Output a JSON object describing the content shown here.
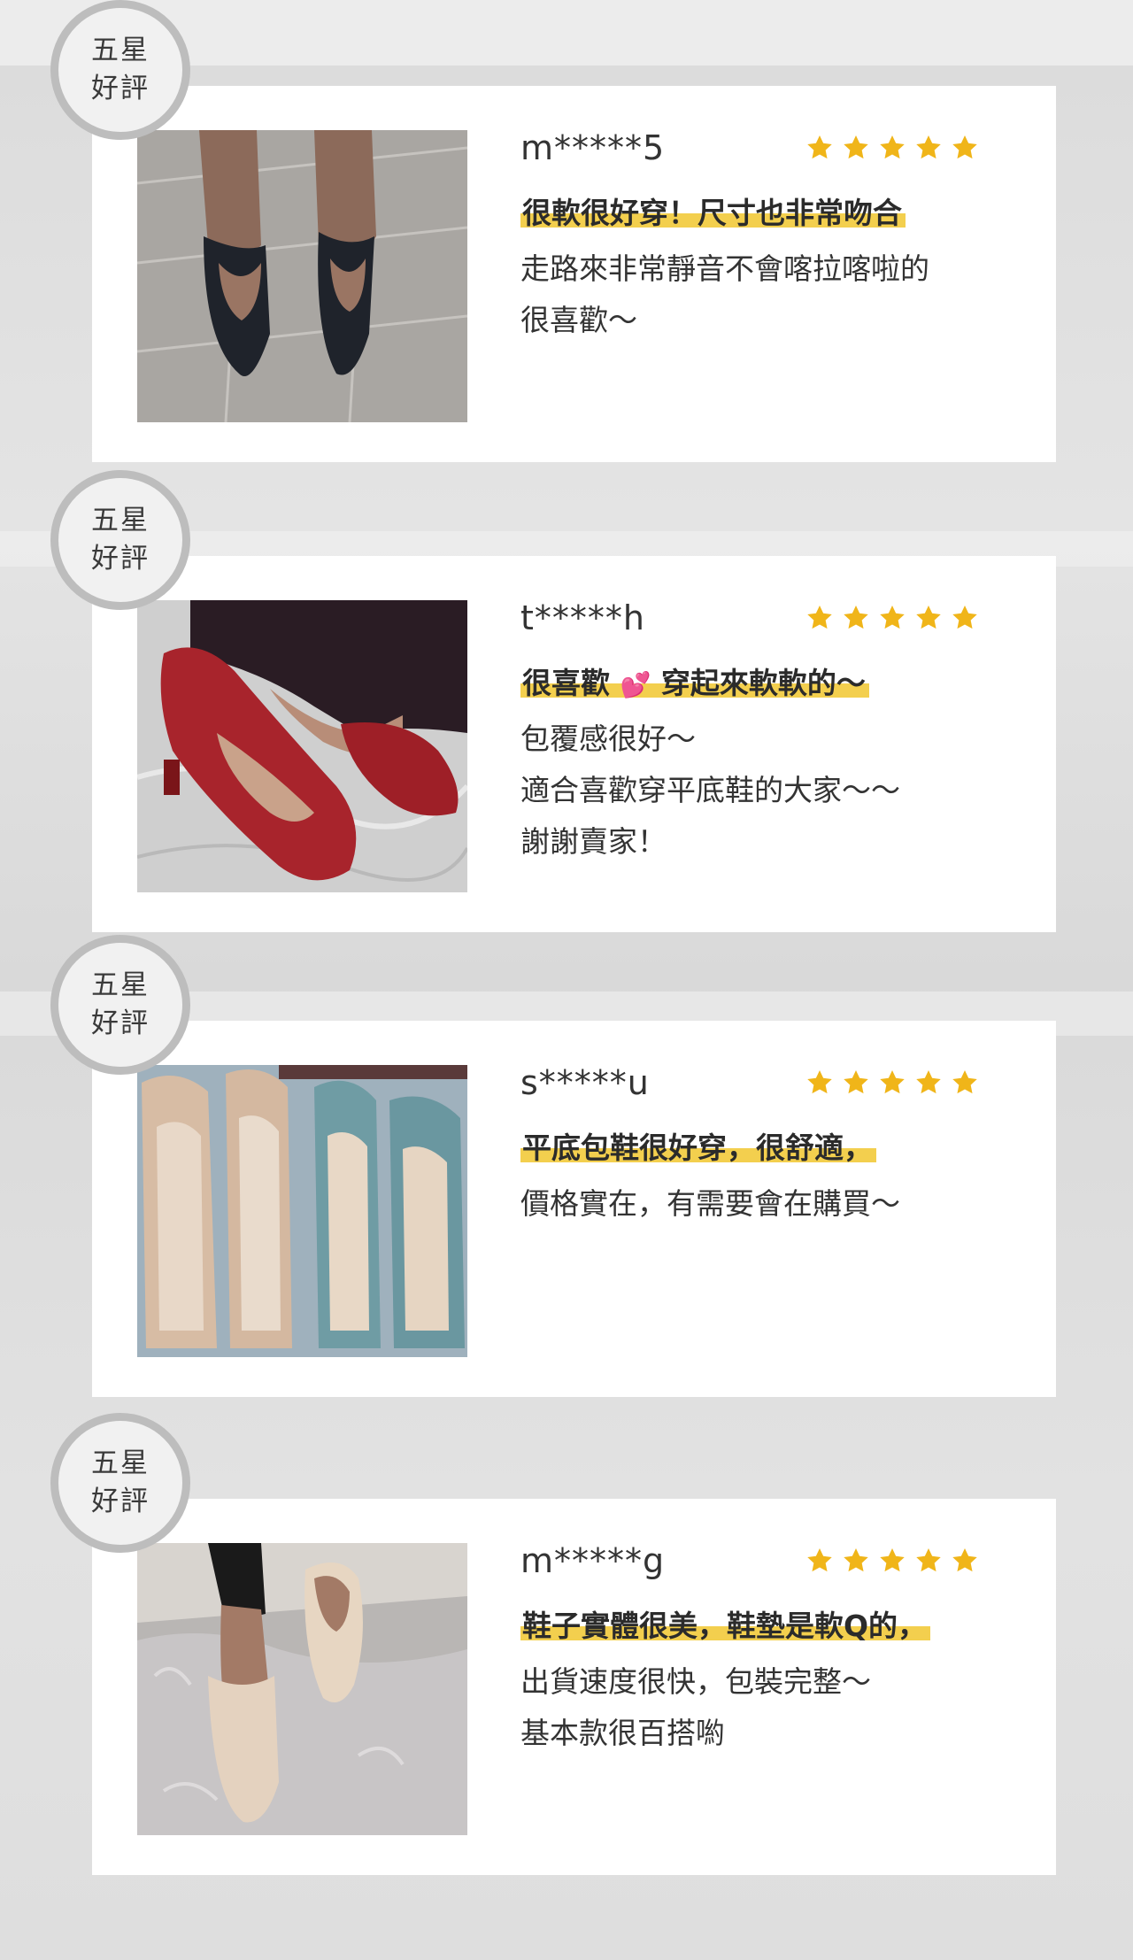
{
  "colors": {
    "star": "#f0b519",
    "highlight": "#f3cf4e",
    "badge_ring": "#bdbdbd"
  },
  "reviews": [
    {
      "badge_line1": "五星",
      "badge_line2": "好評",
      "user": "m*****5",
      "rating": 5,
      "headline": "很軟很好穿！尺寸也非常吻合",
      "headline_pre": "",
      "headline_post": "",
      "lines": [
        "走路來非常靜音不會喀拉喀啦的",
        "很喜歡～"
      ],
      "photo": "black-flat-shoes-photo"
    },
    {
      "badge_line1": "五星",
      "badge_line2": "好評",
      "user": "t*****h",
      "rating": 5,
      "headline_pre": "很喜歡",
      "headline_icon": "heart-icon",
      "headline_post": "穿起來軟軟的～",
      "lines": [
        "包覆感很好～",
        "適合喜歡穿平底鞋的大家～～",
        "謝謝賣家！"
      ],
      "photo": "red-flat-shoes-photo"
    },
    {
      "badge_line1": "五星",
      "badge_line2": "好評",
      "user": "s*****u",
      "rating": 5,
      "headline": "平底包鞋很好穿，很舒適，",
      "lines": [
        "價格實在，有需要會在購買～"
      ],
      "photo": "beige-and-teal-shoes-photo"
    },
    {
      "badge_line1": "五星",
      "badge_line2": "好評",
      "user": "m*****g",
      "rating": 5,
      "headline": "鞋子實體很美，鞋墊是軟Q的，",
      "lines": [
        "出貨速度很快，包裝完整～",
        "基本款很百搭喲"
      ],
      "photo": "cream-flat-shoes-photo"
    }
  ]
}
